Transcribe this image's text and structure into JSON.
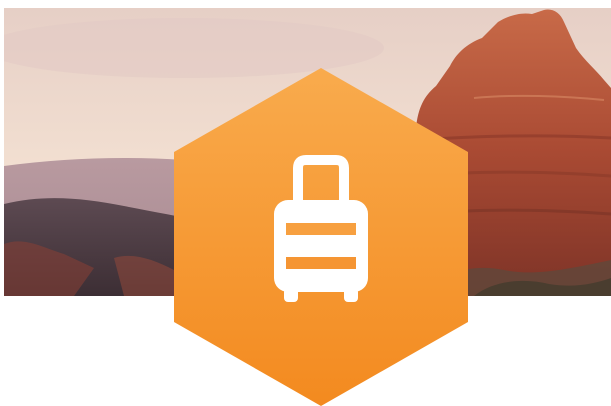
{
  "banner": {
    "scene": "desert-canyon-landscape",
    "sky_top": "#e9d2c4",
    "sky_bottom": "#f3e1d3",
    "rock_color": "#b5553a",
    "hill_color": "#4a3a3c"
  },
  "badge": {
    "icon": "luggage-icon",
    "color_top": "#f8a948",
    "color_bottom": "#f38a1e",
    "icon_color": "#ffffff"
  }
}
